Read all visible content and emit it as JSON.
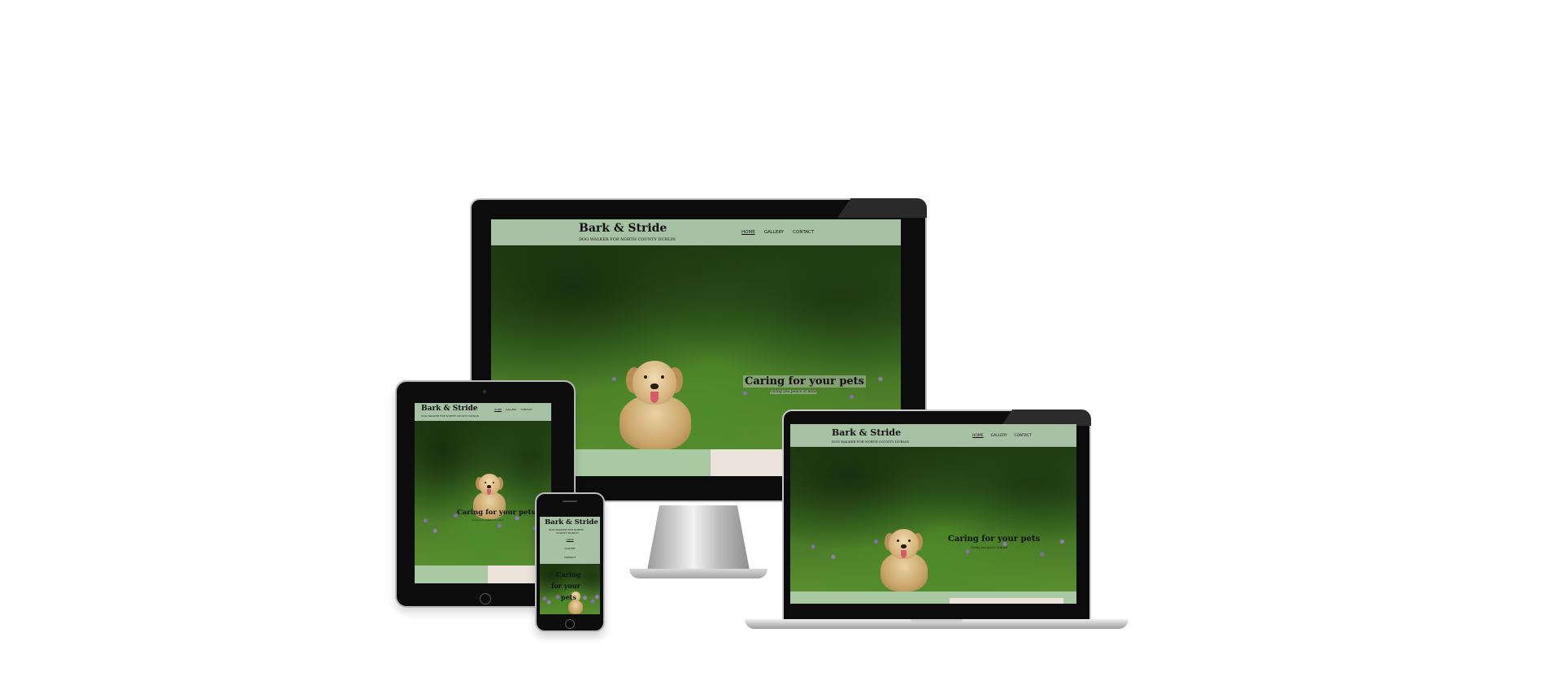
{
  "site": {
    "brand": "Bark & Stride",
    "tagline": "DOG WALKER FOR NORTH COUNTY DUBLIN",
    "tagline_mobile_1": "DOG WALKER FOR NORTH",
    "tagline_mobile_2": "COUNTY DUBLIN",
    "nav": [
      "HOME",
      "GALLERY",
      "CONTACT"
    ],
    "hero_title": "Caring for your pets",
    "hero_title_mobile_1": "Caring",
    "hero_title_mobile_2": "for your",
    "hero_title_mobile_3": "pets",
    "hero_subtitle": "Giving you peace of mind"
  },
  "colors": {
    "header": "#a7c1a4",
    "footer": "#a8c9a2",
    "beige": "#ebe3da"
  }
}
